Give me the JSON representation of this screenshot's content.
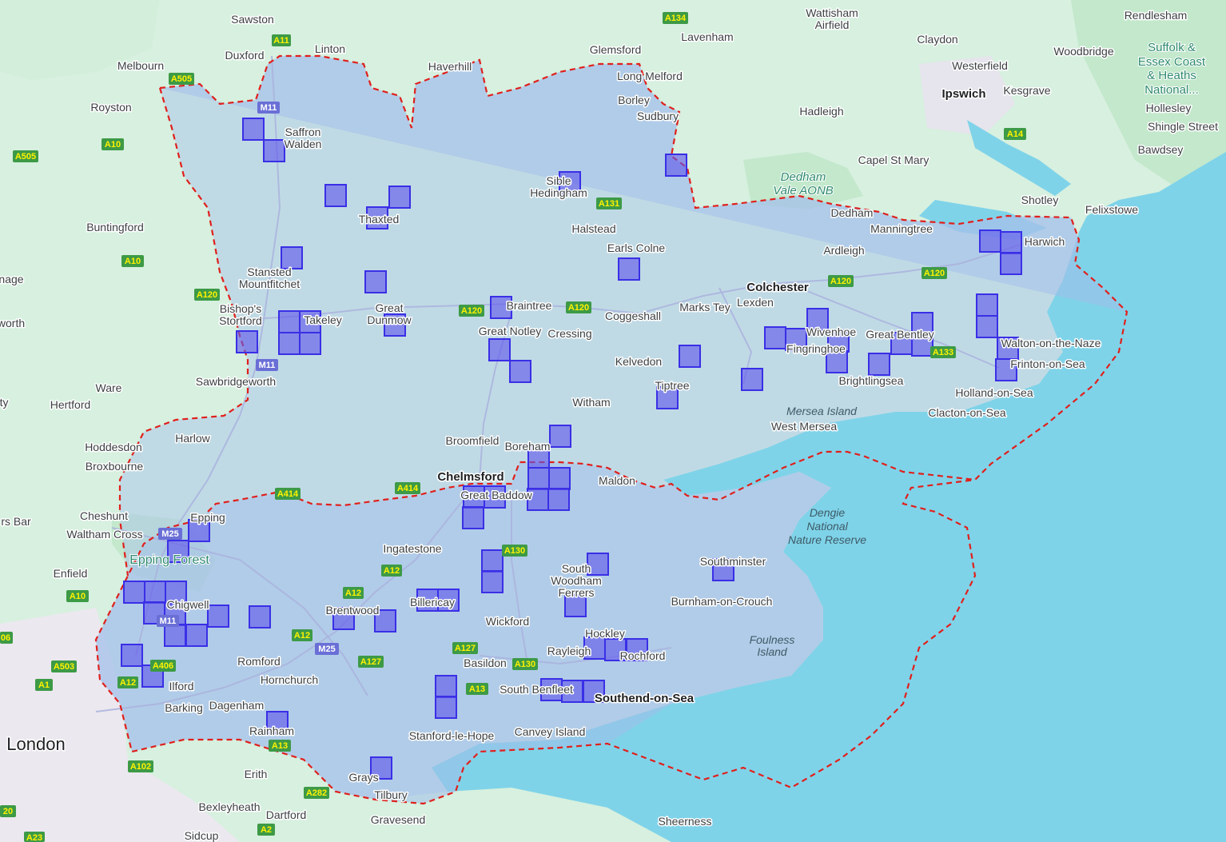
{
  "map": {
    "colors": {
      "land": "#d7f0df",
      "green": "#bfe6c8",
      "sea": "#79d1e8",
      "urban": "#e7e3ee",
      "county": "rgba(150,180,230,0.45)",
      "boundary": "#e0201c",
      "grid": "rgba(90,80,230,0.62)",
      "grid_stroke": "#3a2fe6",
      "road": "#b8bde0",
      "shield": "#3d9a46",
      "motorway": "#6a6fd6"
    },
    "grid_squares_count": 82,
    "places": {
      "sawston": "Sawston",
      "linton": "Linton",
      "haverhill": "Haverhill",
      "glemsford": "Glemsford",
      "lavenham": "Lavenham",
      "wattisham": "Wattisham",
      "airfield": "Airfield",
      "claydon": "Claydon",
      "rendlesham": "Rendlesham",
      "melbourn": "Melbourn",
      "duxford": "Duxford",
      "long_melford": "Long Melford",
      "westerfield": "Westerfield",
      "woodbridge": "Woodbridge",
      "suffolk1": "Suffolk &",
      "suffolk2": "Essex Coast",
      "suffolk3": "& Heaths",
      "suffolk4": "National...",
      "royston": "Royston",
      "saffron1": "Saffron",
      "saffron2": "Walden",
      "borley": "Borley",
      "sudbury": "Sudbury",
      "hadleigh": "Hadleigh",
      "ipswich": "Ipswich",
      "kesgrave": "Kesgrave",
      "hollesley": "Hollesley",
      "shingle": "Shingle Street",
      "bawdsey": "Bawdsey",
      "capel": "Capel St Mary",
      "sible1": "Sible",
      "sible2": "Hedingham",
      "dedham_vale1": "Dedham",
      "dedham_vale2": "Vale AONB",
      "thaxted": "Thaxted",
      "shotley": "Shotley",
      "felixstowe": "Felixstowe",
      "buntingford": "Buntingford",
      "halstead": "Halstead",
      "dedham": "Dedham",
      "manningtree": "Manningtree",
      "harwich": "Harwich",
      "earls_colne": "Earls Colne",
      "ardleigh": "Ardleigh",
      "stansted1": "Stansted",
      "stansted2": "Mountfitchet",
      "colchester": "Colchester",
      "age": "nage",
      "bishops1": "Bishop's",
      "bishops2": "Stortford",
      "takeley": "Takeley",
      "great_dunmow1": "Great",
      "great_dunmow2": "Dunmow",
      "braintree": "Braintree",
      "coggeshall": "Coggeshall",
      "marks_tey": "Marks Tey",
      "lexden": "Lexden",
      "worth": "worth",
      "great_notley": "Great Notley",
      "cressing": "Cressing",
      "wivenhoe": "Wivenhoe",
      "great_bentley": "Great Bentley",
      "fingringhoe": "Fingringhoe",
      "walton": "Walton-on-the-Naze",
      "kelvedon": "Kelvedon",
      "frinton": "Frinton-on-Sea",
      "sawbridgeworth": "Sawbridgeworth",
      "brightlingsea": "Brightlingsea",
      "ware": "Ware",
      "tiptree": "Tiptree",
      "holland": "Holland-on-Sea",
      "hertford": "Hertford",
      "witham": "Witham",
      "ty": "ty",
      "mersea_island": "Mersea Island",
      "clacton": "Clacton-on-Sea",
      "west_mersea": "West Mersea",
      "harlow": "Harlow",
      "broomfield": "Broomfield",
      "boreham": "Boreham",
      "hoddesdon": "Hoddesdon",
      "broxbourne": "Broxbourne",
      "chelmsford": "Chelmsford",
      "maldon": "Maldon",
      "great_baddow": "Great Baddow",
      "cheshunt": "Cheshunt",
      "dengie1": "Dengie",
      "dengie2": "National",
      "dengie3": "Nature Reserve",
      "rs_bar": "rs Bar",
      "epping": "Epping",
      "waltham_cross": "Waltham Cross",
      "epping_forest": "Epping Forest",
      "ingatestone": "Ingatestone",
      "southminster": "Southminster",
      "enfield": "Enfield",
      "south_woodham1": "South",
      "south_woodham2": "Woodham",
      "south_woodham3": "Ferrers",
      "chigwell": "Chigwell",
      "billericay": "Billericay",
      "burnham": "Burnham-on-Crouch",
      "brentwood": "Brentwood",
      "wickford": "Wickford",
      "hockley": "Hockley",
      "foulness1": "Foulness",
      "foulness2": "Island",
      "rayleigh": "Rayleigh",
      "rochford": "Rochford",
      "romford": "Romford",
      "basildon": "Basildon",
      "hornchurch": "Hornchurch",
      "ilford": "Ilford",
      "south_benfleet": "South Benfleet",
      "southend": "Southend-on-Sea",
      "barking": "Barking",
      "dagenham": "Dagenham",
      "rainham": "Rainham",
      "stanford": "Stanford-le-Hope",
      "canvey": "Canvey Island",
      "london": "London",
      "erith": "Erith",
      "grays": "Grays",
      "tilbury": "Tilbury",
      "bexleyheath": "Bexleyheath",
      "dartford": "Dartford",
      "gravesend": "Gravesend",
      "sheerness": "Sheerness",
      "sidcup": "Sidcup"
    },
    "roads": {
      "a134": "A134",
      "a11": "A11",
      "a505_top": "A505",
      "a505_left": "A505",
      "m11_top": "M11",
      "a10_top": "A10",
      "a14": "A14",
      "a131": "A131",
      "a10_mid": "A10",
      "a120_bs": "A120",
      "a120_bt": "A120",
      "a120_bt2": "A120",
      "a120_col": "A120",
      "a120_east": "A120",
      "a133": "A133",
      "m11_mid": "M11",
      "a414_w": "A414",
      "a414_e": "A414",
      "m25_epping": "M25",
      "a130_n": "A130",
      "a12_ing": "A12",
      "a10_enf": "A10",
      "a12_brent": "A12",
      "m11_chig": "M11",
      "a12_rom": "A12",
      "m25_brent": "M25",
      "a127_bas": "A127",
      "a127_w": "A127",
      "a130_s": "A130",
      "a503": "A503",
      "a406": "A406",
      "a06": "06",
      "a1": "A1",
      "a12_ilf": "A12",
      "a13_w": "A13",
      "a13_e": "A13",
      "a102": "A102",
      "a282": "A282",
      "a2": "A2",
      "a23": "A23",
      "a20": "20"
    }
  }
}
